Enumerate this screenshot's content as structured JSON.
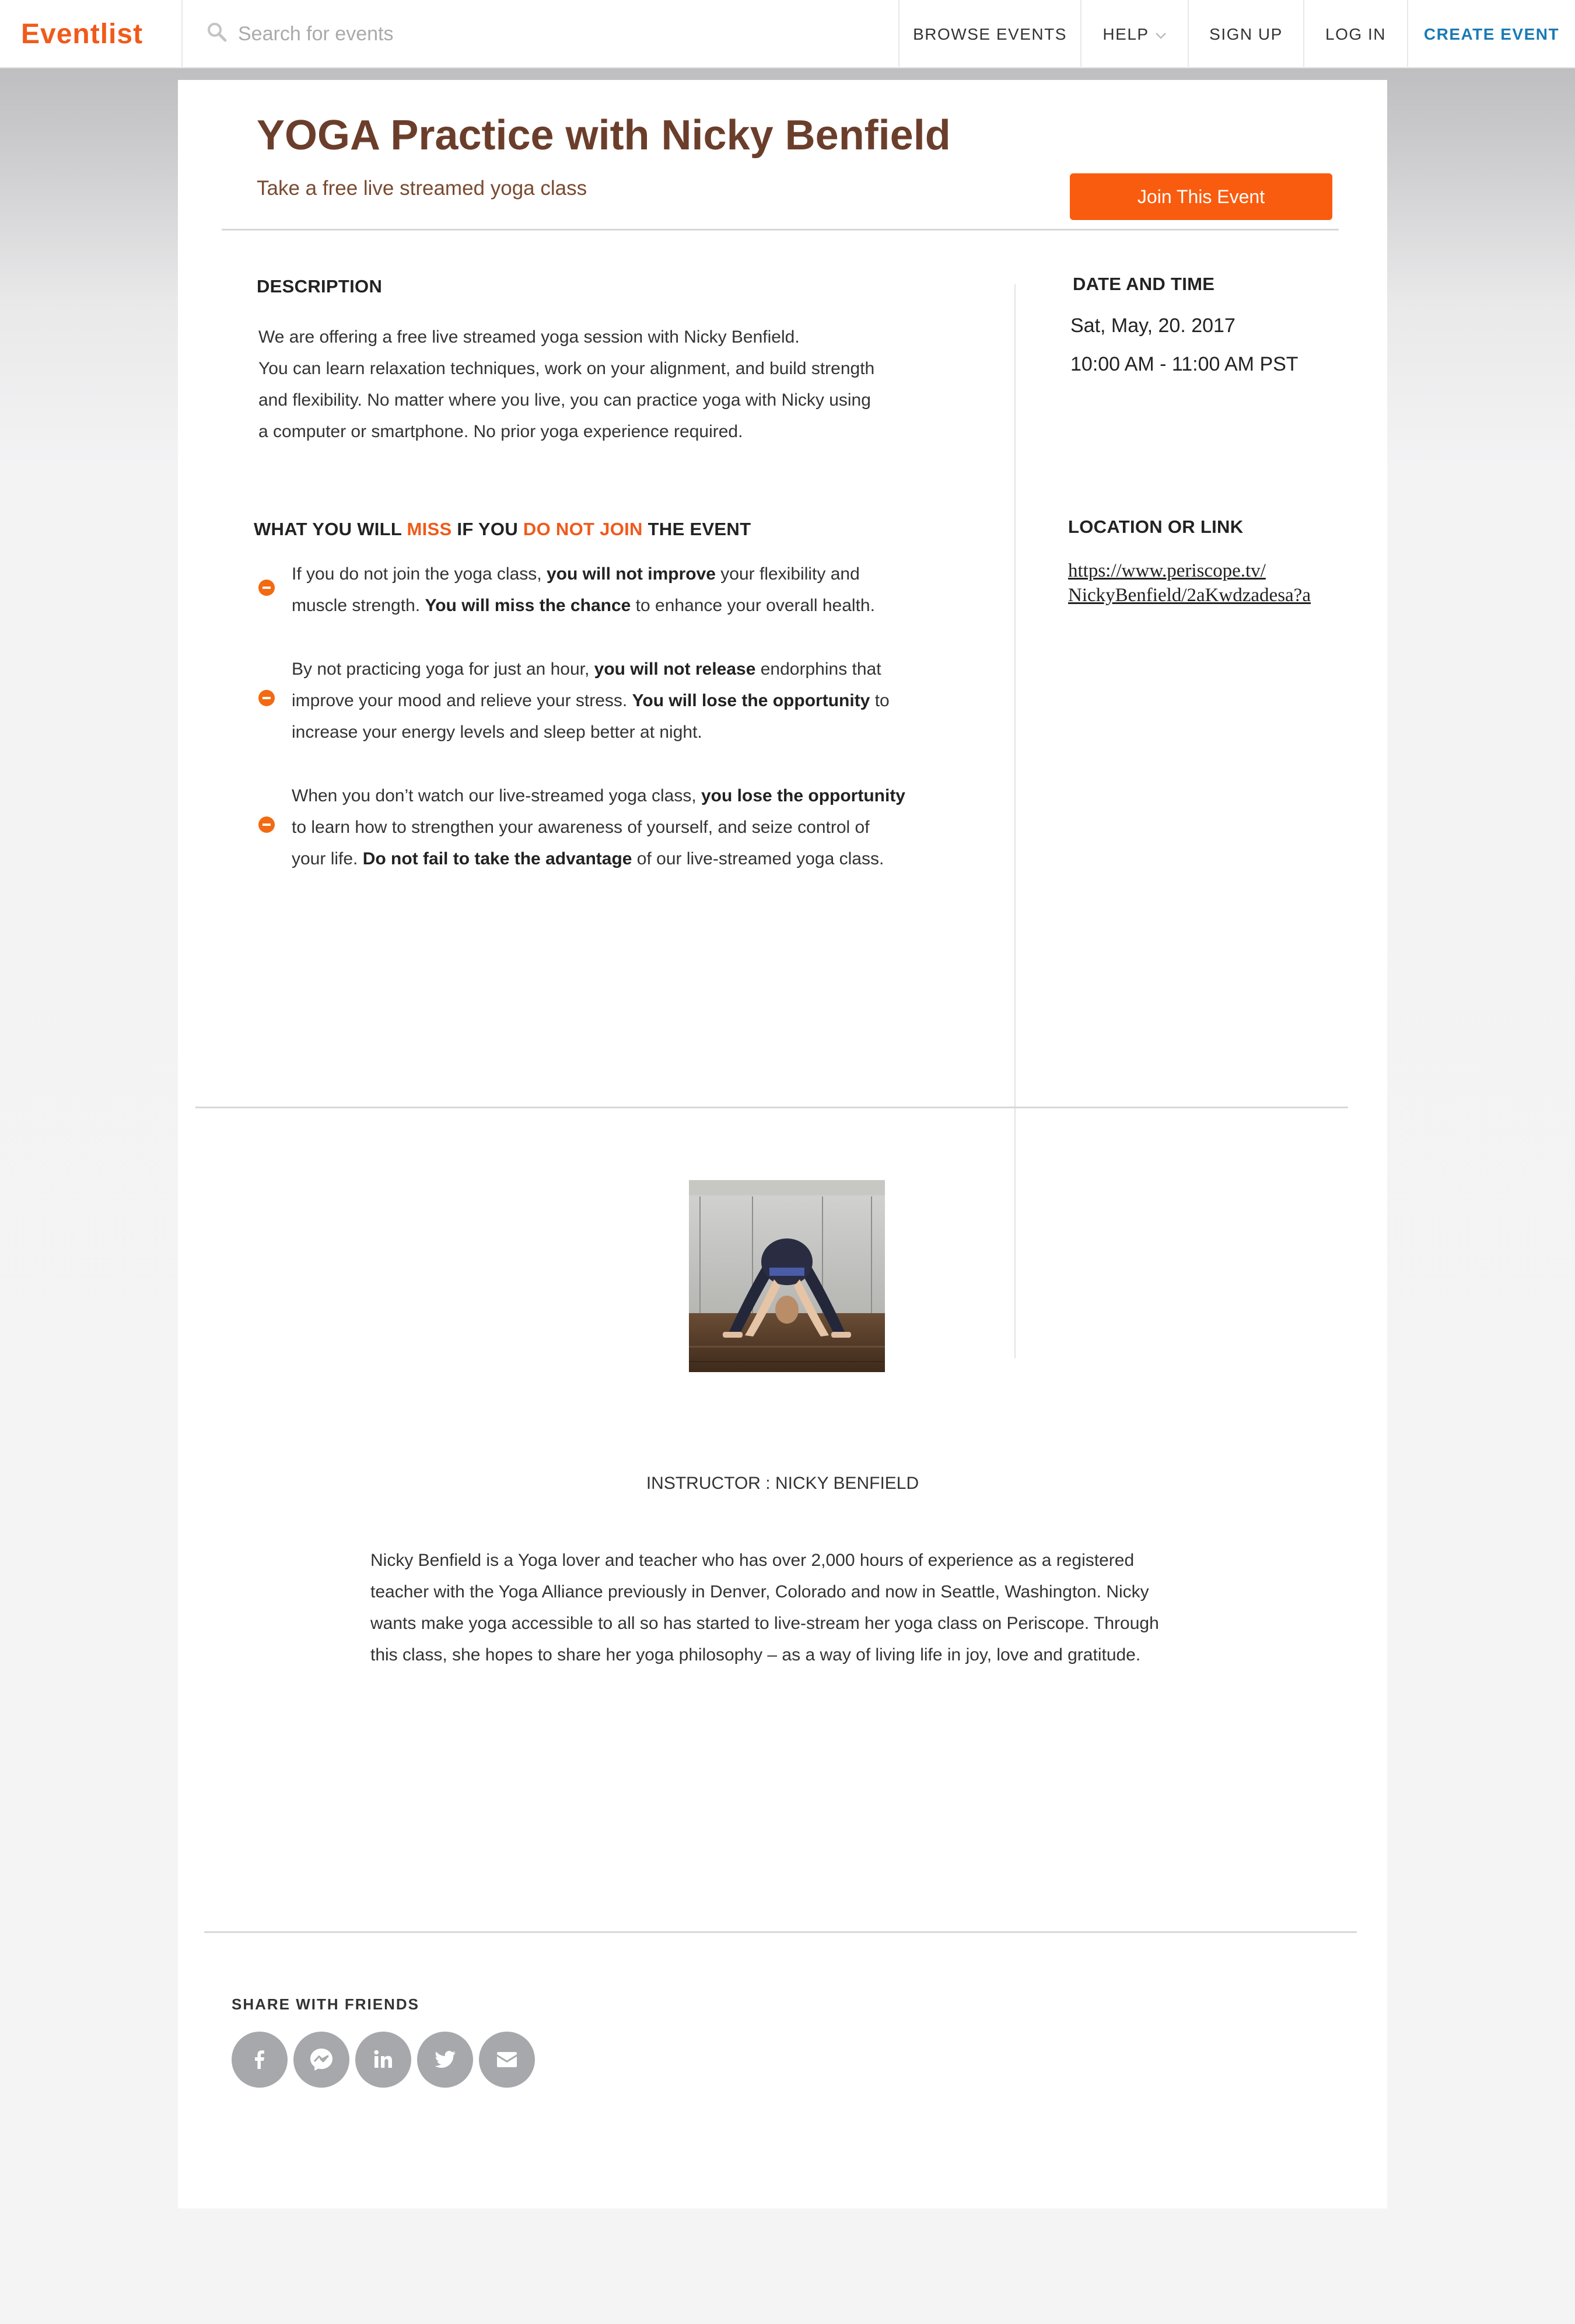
{
  "nav": {
    "logo": "Eventlist",
    "search_placeholder": "Search for events",
    "items": [
      "BROWSE EVENTS",
      "HELP",
      "SIGN UP",
      "LOG IN"
    ],
    "create": "CREATE EVENT"
  },
  "event": {
    "title": "YOGA Practice with Nicky Benfield",
    "subtitle": "Take a free live streamed yoga class",
    "join_label": "Join This Event"
  },
  "description": {
    "heading": "DESCRIPTION",
    "lines": [
      "We are offering a free live streamed yoga session with Nicky Benfield.",
      "You can learn relaxation techniques, work on your alignment, and build strength",
      "and flexibility. No matter where you live, you can practice yoga with Nicky  using",
      "a computer or smartphone. No prior yoga experience required."
    ]
  },
  "miss": {
    "heading_parts": [
      "WHAT YOU WILL ",
      "MISS",
      " IF YOU ",
      "DO NOT JOIN",
      " THE EVENT"
    ],
    "items": [
      {
        "lines": [
          [
            [
              "If you do not join the yoga class, ",
              false
            ],
            [
              "you will not improve",
              true
            ],
            [
              " your flexibility and",
              false
            ]
          ],
          [
            [
              "muscle strength. ",
              false
            ],
            [
              "You will miss the chance",
              true
            ],
            [
              " to enhance your overall health.",
              false
            ]
          ]
        ]
      },
      {
        "lines": [
          [
            [
              "By not practicing yoga for just an hour, ",
              false
            ],
            [
              "you will not release",
              true
            ],
            [
              " endorphins that",
              false
            ]
          ],
          [
            [
              "improve your mood and relieve your stress. ",
              false
            ],
            [
              "You will lose the opportunity",
              true
            ],
            [
              " to",
              false
            ]
          ],
          [
            [
              "increase your energy levels and sleep better at night.",
              false
            ]
          ]
        ]
      },
      {
        "lines": [
          [
            [
              "When you don’t watch our live-streamed yoga class, ",
              false
            ],
            [
              "you lose the opportunity",
              true
            ]
          ],
          [
            [
              "to learn how to strengthen your awareness of yourself, and seize control of",
              false
            ]
          ],
          [
            [
              "your life. ",
              false
            ],
            [
              "Do not fail to take the advantage",
              true
            ],
            [
              " of our live-streamed yoga class.",
              false
            ]
          ]
        ]
      }
    ]
  },
  "datetime": {
    "heading": "DATE AND TIME",
    "date": "Sat, May, 20. 2017",
    "time": "10:00 AM - 11:00 AM PST"
  },
  "location": {
    "heading": "LOCATION OR LINK",
    "link_line1": "https://www.periscope.tv/",
    "link_line2": "NickyBenfield/2aKwdzadesa?a"
  },
  "instructor": {
    "label": "INSTRUCTOR : NICKY BENFIELD",
    "bio_lines": [
      "Nicky Benfield is a Yoga lover and teacher who has over 2,000 hours of experience as a registered",
      "teacher with the Yoga Alliance previously in Denver, Colorado and now in Seattle, Washington. Nicky",
      "wants make yoga accessible to all so has started to live-stream her yoga class on Periscope. Through",
      "this class, she hopes to share her yoga philosophy – as a way of living life in joy, love and gratitude."
    ]
  },
  "share": {
    "label": "SHARE WITH FRIENDS",
    "icons": [
      "facebook-icon",
      "messenger-icon",
      "linkedin-icon",
      "twitter-icon",
      "email-icon"
    ]
  },
  "colors": {
    "accent": "#f05a1a",
    "button": "#f95c0e",
    "title_brown": "#6b3e2b",
    "link_blue": "#1a7ab5",
    "share_grey": "#a7a8ac"
  }
}
